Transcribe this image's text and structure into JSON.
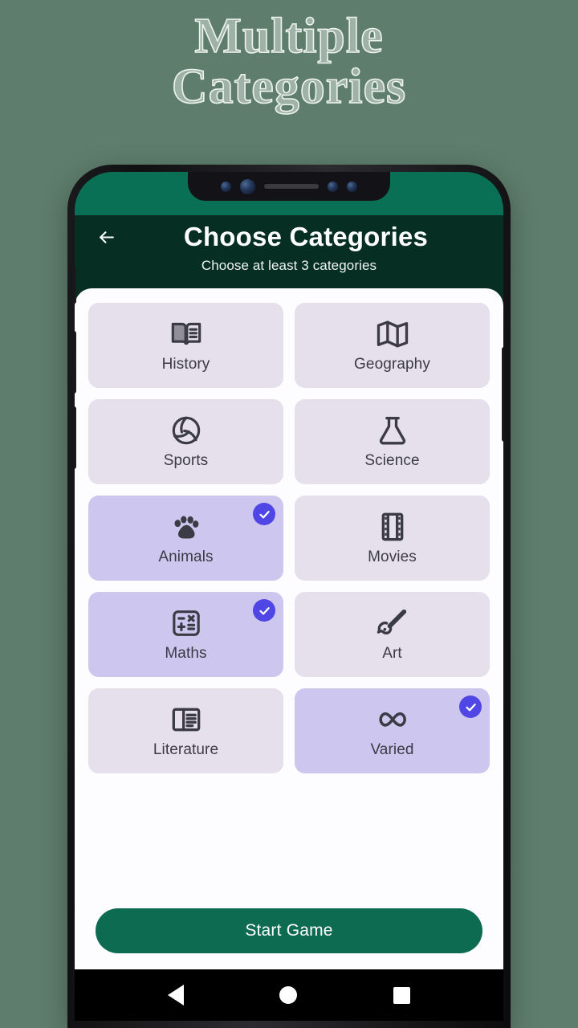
{
  "promo": {
    "line1": "Multiple",
    "line2": "Categories"
  },
  "colors": {
    "page_background": "#5e7d6c",
    "status_bar": "#097055",
    "app_bar": "#062e23",
    "sheet": "#fdfcfe",
    "card_unselected": "#e6e0ec",
    "card_selected": "#cdc6ee",
    "check_badge": "#4f46e5",
    "cta_button": "#0d6b51",
    "icon": "#3b3b46"
  },
  "appbar": {
    "back_icon": "arrow-left-icon",
    "title": "Choose Categories",
    "subtitle": "Choose at least 3 categories"
  },
  "statusbar": {
    "camera_icon": "camera-lens-icon",
    "speaker_icon": "earpiece-speaker-icon"
  },
  "categories": [
    {
      "label": "History",
      "icon": "book-open-icon",
      "selected": false,
      "check_icon": "check-circle-icon"
    },
    {
      "label": "Geography",
      "icon": "map-icon",
      "selected": false,
      "check_icon": "check-circle-icon"
    },
    {
      "label": "Sports",
      "icon": "volleyball-icon",
      "selected": false,
      "check_icon": "check-circle-icon"
    },
    {
      "label": "Science",
      "icon": "flask-icon",
      "selected": false,
      "check_icon": "check-circle-icon"
    },
    {
      "label": "Animals",
      "icon": "paw-print-icon",
      "selected": true,
      "check_icon": "check-circle-icon"
    },
    {
      "label": "Movies",
      "icon": "film-strip-icon",
      "selected": false,
      "check_icon": "check-circle-icon"
    },
    {
      "label": "Maths",
      "icon": "calculator-icon",
      "selected": true,
      "check_icon": "check-circle-icon"
    },
    {
      "label": "Art",
      "icon": "paintbrush-icon",
      "selected": false,
      "check_icon": "check-circle-icon"
    },
    {
      "label": "Literature",
      "icon": "article-icon",
      "selected": false,
      "check_icon": "check-circle-icon"
    },
    {
      "label": "Varied",
      "icon": "infinity-icon",
      "selected": true,
      "check_icon": "check-circle-icon"
    }
  ],
  "cta": {
    "label": "Start Game"
  },
  "navbar": {
    "back": "nav-back-icon",
    "home": "nav-home-icon",
    "recents": "nav-recents-icon"
  }
}
